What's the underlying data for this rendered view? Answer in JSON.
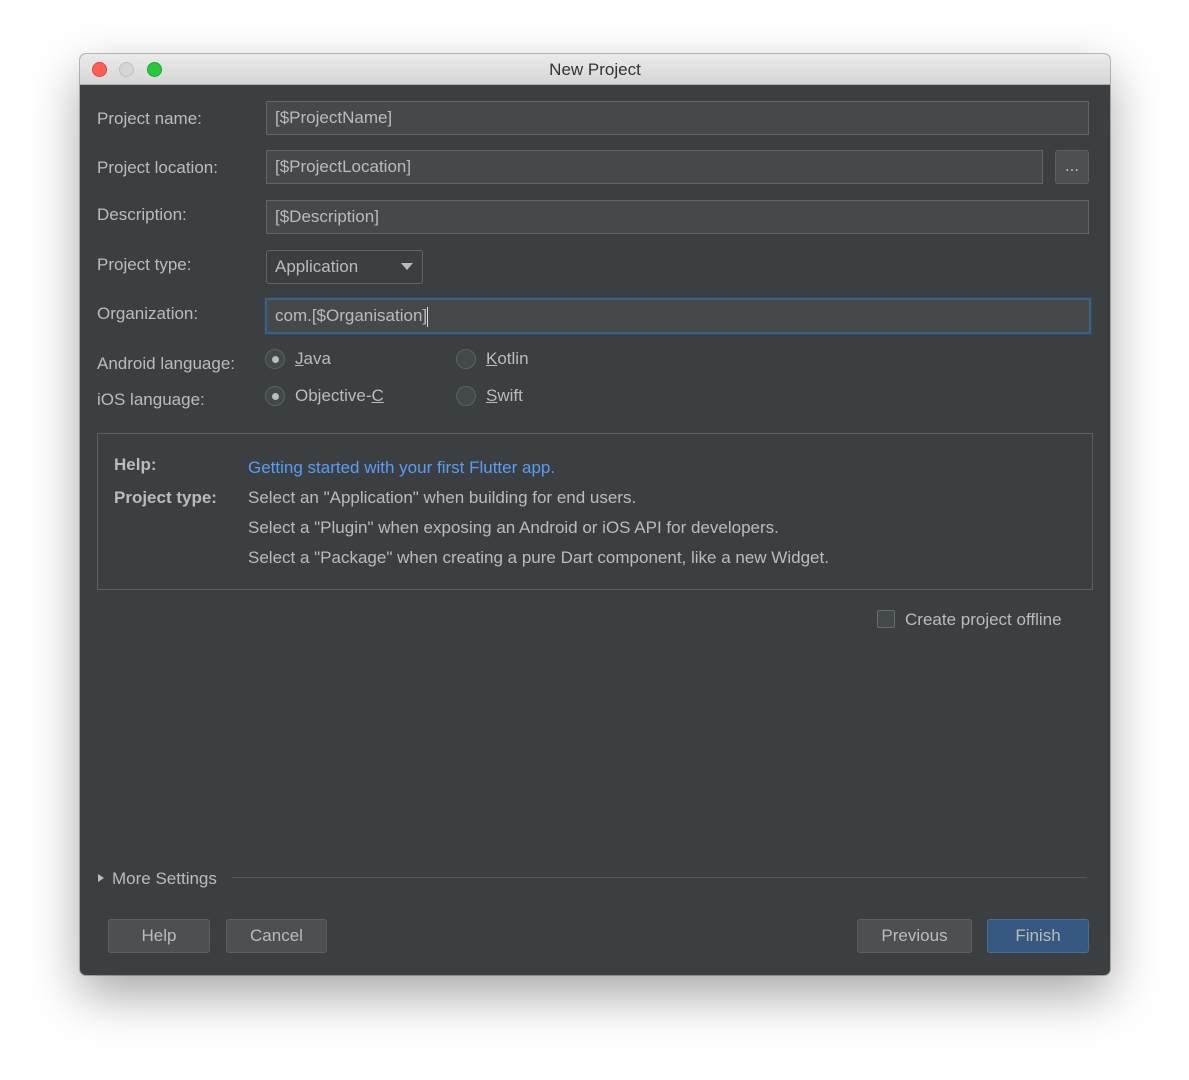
{
  "window": {
    "title": "New Project"
  },
  "form": {
    "project_name": {
      "label": "Project name:",
      "value": "[$ProjectName]"
    },
    "project_location": {
      "label": "Project location:",
      "value": "[$ProjectLocation]",
      "browse_label": "..."
    },
    "description": {
      "label": "Description:",
      "value": "[$Description]"
    },
    "project_type": {
      "label": "Project type:",
      "selected": "Application"
    },
    "organization": {
      "label": "Organization:",
      "value": "com.[$Organisation]"
    },
    "android_language": {
      "label": "Android language:",
      "options": [
        {
          "label": "Java",
          "mnemonic": "J",
          "rest": "ava",
          "selected": true
        },
        {
          "label": "Kotlin",
          "mnemonic": "K",
          "rest": "otlin",
          "selected": false
        }
      ]
    },
    "ios_language": {
      "label": "iOS language:",
      "options": [
        {
          "label": "Objective-C",
          "pre": "Objective-",
          "mnemonic": "C",
          "selected": true
        },
        {
          "label": "Swift",
          "mnemonic": "S",
          "rest": "wift",
          "selected": false
        }
      ]
    }
  },
  "help": {
    "help_label": "Help:",
    "link": "Getting started with your first Flutter app.",
    "type_label": "Project type:",
    "lines": [
      "Select an \"Application\" when building for end users.",
      "Select a \"Plugin\" when exposing an Android or iOS API for developers.",
      "Select a \"Package\" when creating a pure Dart component, like a new Widget."
    ]
  },
  "offline": {
    "label": "Create project offline",
    "checked": false
  },
  "more_settings": "More Settings",
  "buttons": {
    "help": "Help",
    "cancel": "Cancel",
    "previous": "Previous",
    "finish": "Finish"
  },
  "colors": {
    "accent": "#365880",
    "link": "#589df6",
    "focus": "#3d6185"
  }
}
